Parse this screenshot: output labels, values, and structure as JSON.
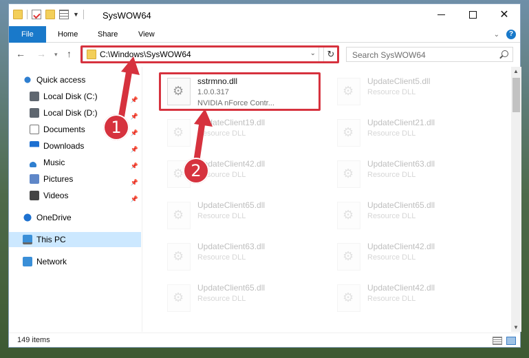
{
  "window": {
    "title": "SysWOW64",
    "controls": {
      "minimize": "—",
      "maximize": "☐",
      "close": "✕"
    }
  },
  "ribbon": {
    "tabs": [
      {
        "label": "File"
      },
      {
        "label": "Home"
      },
      {
        "label": "Share"
      },
      {
        "label": "View"
      }
    ],
    "help": "?"
  },
  "navigation": {
    "address": "C:\\Windows\\SysWOW64",
    "search_placeholder": "Search SysWOW64"
  },
  "sidebar": {
    "items": [
      {
        "label": "Quick access",
        "icon": "star-icon"
      },
      {
        "label": "Local Disk (C:)",
        "icon": "disk-icon"
      },
      {
        "label": "Local Disk (D:)",
        "icon": "disk-icon"
      },
      {
        "label": "Documents",
        "icon": "documents-icon"
      },
      {
        "label": "Downloads",
        "icon": "downloads-icon"
      },
      {
        "label": "Music",
        "icon": "music-icon"
      },
      {
        "label": "Pictures",
        "icon": "pictures-icon"
      },
      {
        "label": "Videos",
        "icon": "videos-icon"
      },
      {
        "label": "OneDrive",
        "icon": "cloud-icon"
      },
      {
        "label": "This PC",
        "icon": "computer-icon"
      },
      {
        "label": "Network",
        "icon": "network-icon"
      }
    ]
  },
  "files": {
    "highlighted": {
      "name": "sstrmno.dll",
      "version": "1.0.0.317",
      "description": "NVIDIA nForce Contr..."
    },
    "items": [
      {
        "name": "UpdateClient5.dll",
        "sub": "Resource DLL"
      },
      {
        "name": "UpdateClient19.dll",
        "sub": "Resource DLL"
      },
      {
        "name": "UpdateClient21.dll",
        "sub": "Resource DLL"
      },
      {
        "name": "UpdateClient42.dll",
        "sub": "Resource DLL"
      },
      {
        "name": "UpdateClient63.dll",
        "sub": "Resource DLL"
      },
      {
        "name": "UpdateClient65.dll",
        "sub": "Resource DLL"
      },
      {
        "name": "UpdateClient65.dll",
        "sub": "Resource DLL"
      },
      {
        "name": "UpdateClient63.dll",
        "sub": "Resource DLL"
      },
      {
        "name": "UpdateClient42.dll",
        "sub": "Resource DLL"
      },
      {
        "name": "UpdateClient65.dll",
        "sub": "Resource DLL"
      },
      {
        "name": "UpdateClient42.dll",
        "sub": "Resource DLL"
      }
    ]
  },
  "status": {
    "items_count": "149 items"
  },
  "annotations": {
    "step1": "1",
    "step2": "2",
    "color": "#d6323e"
  }
}
